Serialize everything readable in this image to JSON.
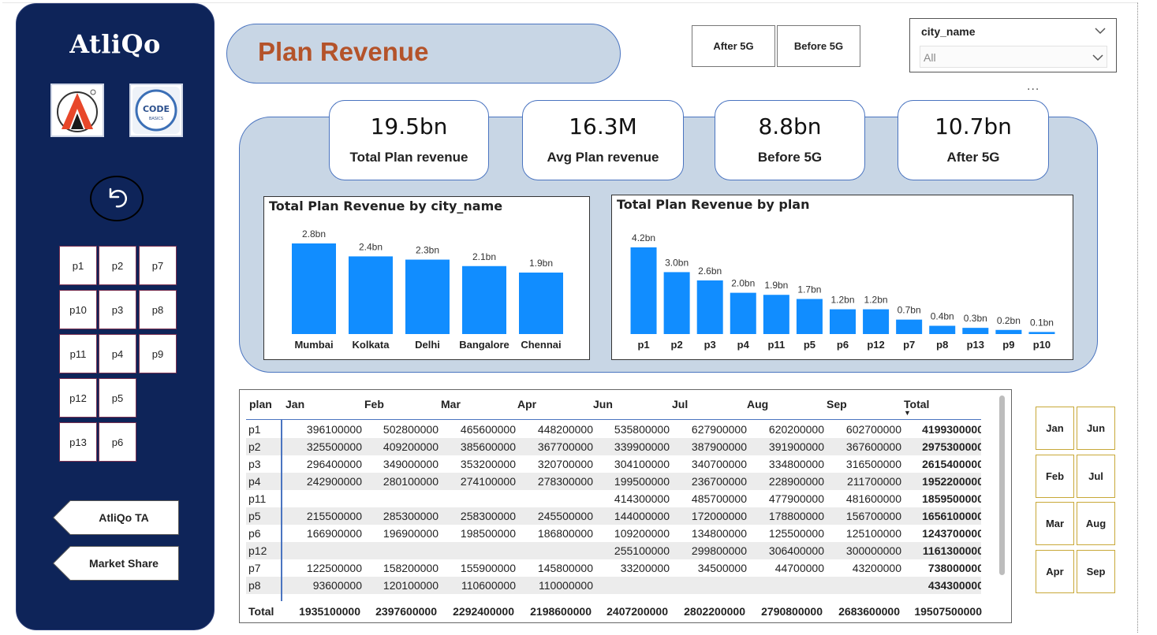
{
  "sidebar": {
    "brand": "AtliQo",
    "plan_buttons": [
      "p1",
      "p2",
      "p7",
      "p10",
      "p3",
      "p8",
      "p11",
      "p4",
      "p9",
      "p12",
      "p5",
      "p13",
      "p6"
    ],
    "nav": [
      "AtliQo TA",
      "Market Share"
    ]
  },
  "header": {
    "title": "Plan Revenue",
    "toggle_after": "After 5G",
    "toggle_before": "Before 5G",
    "slicer_label": "city_name",
    "slicer_value": "All",
    "more": "..."
  },
  "kpis": [
    {
      "value": "19.5bn",
      "caption": "Total Plan revenue"
    },
    {
      "value": "16.3M",
      "caption": "Avg Plan revenue"
    },
    {
      "value": "8.8bn",
      "caption": "Before 5G"
    },
    {
      "value": "10.7bn",
      "caption": "After 5G"
    }
  ],
  "chart_data": [
    {
      "type": "bar",
      "title": "Total Plan Revenue by city_name",
      "categories": [
        "Mumbai",
        "Kolkata",
        "Delhi",
        "Bangalore",
        "Chennai"
      ],
      "values": [
        2.8,
        2.4,
        2.3,
        2.1,
        1.9
      ],
      "labels": [
        "2.8bn",
        "2.4bn",
        "2.3bn",
        "2.1bn",
        "1.9bn"
      ],
      "color": "#118dff"
    },
    {
      "type": "bar",
      "title": "Total Plan Revenue by plan",
      "categories": [
        "p1",
        "p2",
        "p3",
        "p4",
        "p11",
        "p5",
        "p6",
        "p12",
        "p7",
        "p8",
        "p13",
        "p9",
        "p10"
      ],
      "values": [
        4.2,
        3.0,
        2.6,
        2.0,
        1.9,
        1.7,
        1.2,
        1.2,
        0.7,
        0.4,
        0.3,
        0.2,
        0.1
      ],
      "labels": [
        "4.2bn",
        "3.0bn",
        "2.6bn",
        "2.0bn",
        "1.9bn",
        "1.7bn",
        "1.2bn",
        "1.2bn",
        "0.7bn",
        "0.4bn",
        "0.3bn",
        "0.2bn",
        "0.1bn"
      ],
      "color": "#118dff"
    }
  ],
  "matrix": {
    "columns": [
      "plan",
      "Jan",
      "Feb",
      "Mar",
      "Apr",
      "Jun",
      "Jul",
      "Aug",
      "Sep",
      "Total"
    ],
    "rows": [
      [
        "p1",
        "396100000",
        "502800000",
        "465600000",
        "448200000",
        "535800000",
        "627900000",
        "620200000",
        "602700000",
        "4199300000"
      ],
      [
        "p2",
        "325500000",
        "409200000",
        "385600000",
        "367700000",
        "339900000",
        "387900000",
        "391900000",
        "367600000",
        "2975300000"
      ],
      [
        "p3",
        "296400000",
        "349000000",
        "353200000",
        "320700000",
        "304100000",
        "340700000",
        "334800000",
        "316500000",
        "2615400000"
      ],
      [
        "p4",
        "242900000",
        "280100000",
        "274100000",
        "278300000",
        "199500000",
        "236700000",
        "228900000",
        "211700000",
        "1952200000"
      ],
      [
        "p11",
        "",
        "",
        "",
        "",
        "414300000",
        "485700000",
        "477900000",
        "481600000",
        "1859500000"
      ],
      [
        "p5",
        "215500000",
        "285300000",
        "258300000",
        "245500000",
        "144000000",
        "172000000",
        "178800000",
        "156700000",
        "1656100000"
      ],
      [
        "p6",
        "166900000",
        "196900000",
        "198500000",
        "186800000",
        "109200000",
        "134800000",
        "125500000",
        "125100000",
        "1243700000"
      ],
      [
        "p12",
        "",
        "",
        "",
        "",
        "255100000",
        "299800000",
        "306400000",
        "300000000",
        "1161300000"
      ],
      [
        "p7",
        "122500000",
        "158200000",
        "155900000",
        "145800000",
        "33200000",
        "34500000",
        "44700000",
        "43200000",
        "738000000"
      ],
      [
        "p8",
        "93600000",
        "120100000",
        "110600000",
        "110000000",
        "",
        "",
        "",
        "",
        "434300000"
      ]
    ],
    "total": [
      "Total",
      "1935100000",
      "2397600000",
      "2292400000",
      "2198600000",
      "2407200000",
      "2802200000",
      "2790800000",
      "2683600000",
      "19507500000"
    ]
  },
  "months": [
    "Jan",
    "Jun",
    "Feb",
    "Jul",
    "Mar",
    "Aug",
    "Apr",
    "Sep"
  ]
}
